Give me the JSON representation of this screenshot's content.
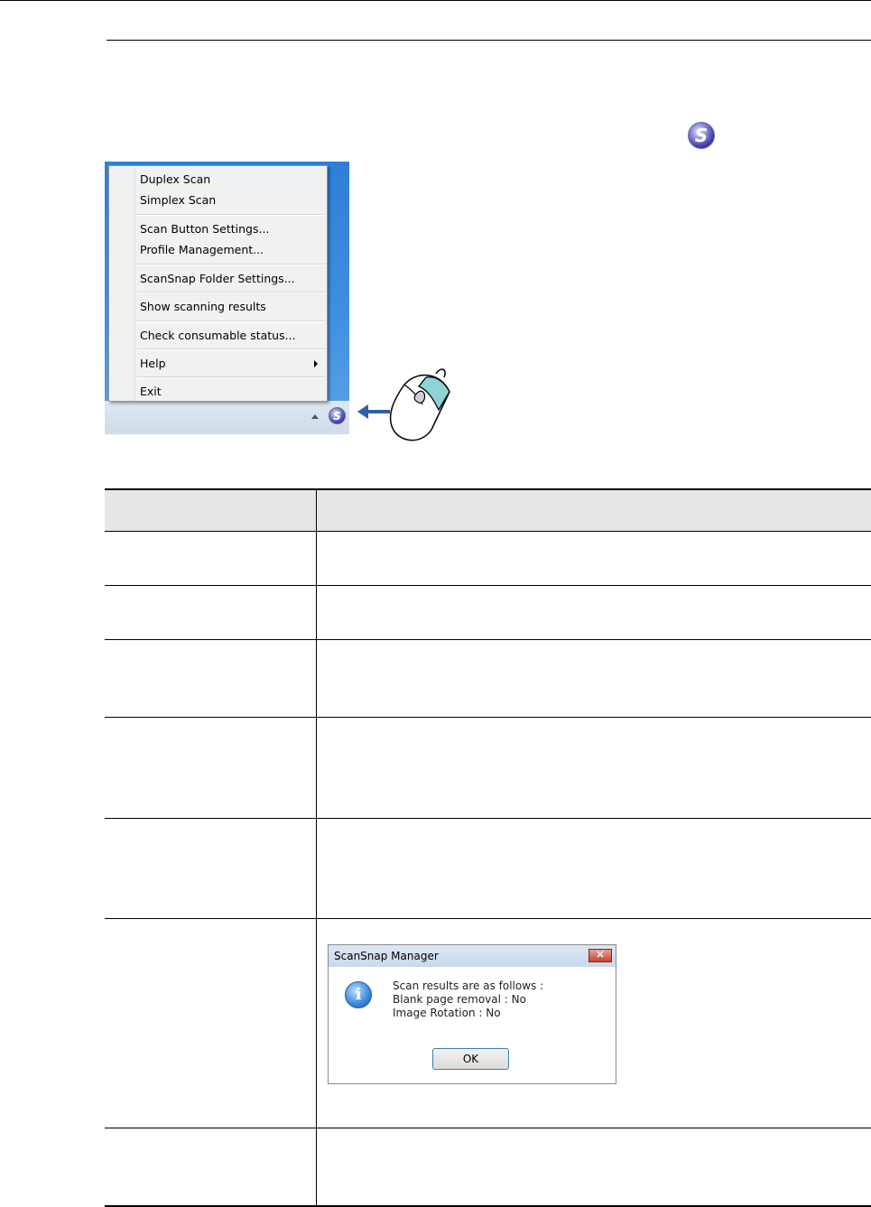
{
  "menu": {
    "items": [
      {
        "label": "Duplex Scan"
      },
      {
        "label": "Simplex Scan"
      },
      {
        "label": "Scan Button Settings..."
      },
      {
        "label": "Profile Management..."
      },
      {
        "label": "ScanSnap Folder Settings..."
      },
      {
        "label": "Show scanning results"
      },
      {
        "label": "Check consumable status..."
      },
      {
        "label": "Help"
      },
      {
        "label": "Exit"
      }
    ]
  },
  "icons": {
    "header_icon": "scansnap-manager-icon",
    "tray_icon": "scansnap-manager-icon",
    "dialog_icon": "info-icon",
    "pointer": "mouse-icon",
    "arrow": "arrow-left-icon"
  },
  "dialog": {
    "title": "ScanSnap Manager",
    "close": "✕",
    "line1": "Scan results are as follows :",
    "line2": "Blank page removal : No",
    "line3": "Image Rotation : No",
    "ok_label": "OK"
  },
  "logo_glyph": "S",
  "colors": {
    "arrow": "#2f5fa6",
    "table_header": "#e6e6e6"
  }
}
